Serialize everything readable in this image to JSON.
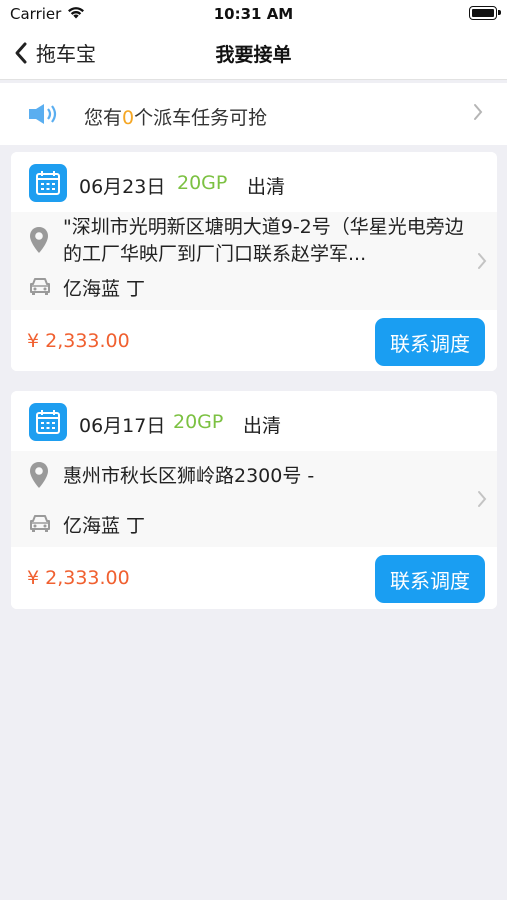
{
  "status_bar": {
    "carrier": "Carrier",
    "time": "10:31 AM"
  },
  "nav": {
    "back_label": "拖车宝",
    "title": "我要接单"
  },
  "notice": {
    "prefix": "您有",
    "count": "0",
    "suffix": "个派车任务可抢"
  },
  "orders": [
    {
      "date": "06月23日",
      "container_type": "20GP",
      "status": "出清",
      "address": "\"深圳市光明新区塘明大道9-2号（华星光电旁边的工厂华映厂到厂门口联系赵学军...",
      "driver": "亿海蓝 丁",
      "price": "¥ 2,333.00",
      "button_label": "联系调度"
    },
    {
      "date": "06月17日",
      "container_type": "20GP",
      "status": "出清",
      "address": "惠州市秋长区狮岭路2300号 -",
      "driver": "亿海蓝 丁",
      "price": "¥ 2,333.00",
      "button_label": "联系调度"
    }
  ],
  "colors": {
    "accent": "#1a9ef2",
    "price": "#f06030",
    "container_type": "#7cc142",
    "notice_count": "#f5a623",
    "background": "#efeff4"
  }
}
